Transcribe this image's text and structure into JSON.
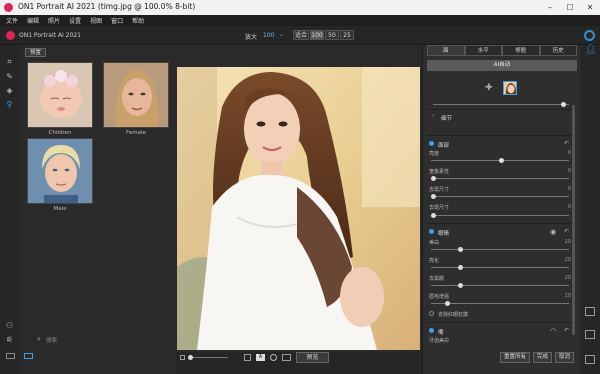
{
  "window": {
    "title": "ON1 Portrait AI 2021 (timg.jpg @ 100.0% 8-bit)",
    "minimize": "–",
    "maximize": "☐",
    "close": "✕"
  },
  "menu": [
    "文件",
    "编辑",
    "照片",
    "设置",
    "视图",
    "窗口",
    "帮助"
  ],
  "topbar": {
    "app_name": "ON1 Portrait AI 2021",
    "zoom_label": "放大",
    "zoom_value": "100",
    "zoom_buttons": [
      "适合",
      "100",
      "50",
      "25"
    ]
  },
  "browser": {
    "breadcrumb": "预置",
    "thumbnails": [
      {
        "label": "Children"
      },
      {
        "label": "Female"
      },
      {
        "label": "Male"
      }
    ],
    "search_placeholder": "搜索"
  },
  "canvas": {
    "preview_button": "预览"
  },
  "panel": {
    "tabs": [
      "面",
      "水平",
      "修脸",
      "历史"
    ],
    "ai_match_label": "AI自动",
    "details_label": "细节",
    "skin": {
      "title": "面部",
      "rows": [
        {
          "label": "亮度",
          "value": "0"
        },
        {
          "label": "宽像素性",
          "value": "0"
        },
        {
          "label": "去斑尺寸",
          "value": "0"
        },
        {
          "label": "去斑尺寸",
          "value": "0"
        }
      ]
    },
    "eyes": {
      "title": "眼睛",
      "rows": [
        {
          "label": "美白",
          "value": "20"
        },
        {
          "label": "亮化",
          "value": "20"
        },
        {
          "label": "去黑眼",
          "value": "20"
        },
        {
          "label": "眉毛增强",
          "value": "10"
        }
      ],
      "checkbox_label": "去除红眼虹膜"
    },
    "mouth": {
      "title": "嘴",
      "row": "牙齿美白"
    },
    "buttons": [
      "重置所有",
      "完成",
      "取消"
    ]
  },
  "colors": {
    "accent": "#3ea0e8",
    "brand": "#e0245a",
    "panel_bg": "#2e2e2e",
    "app_bg": "#2b2b2b"
  }
}
